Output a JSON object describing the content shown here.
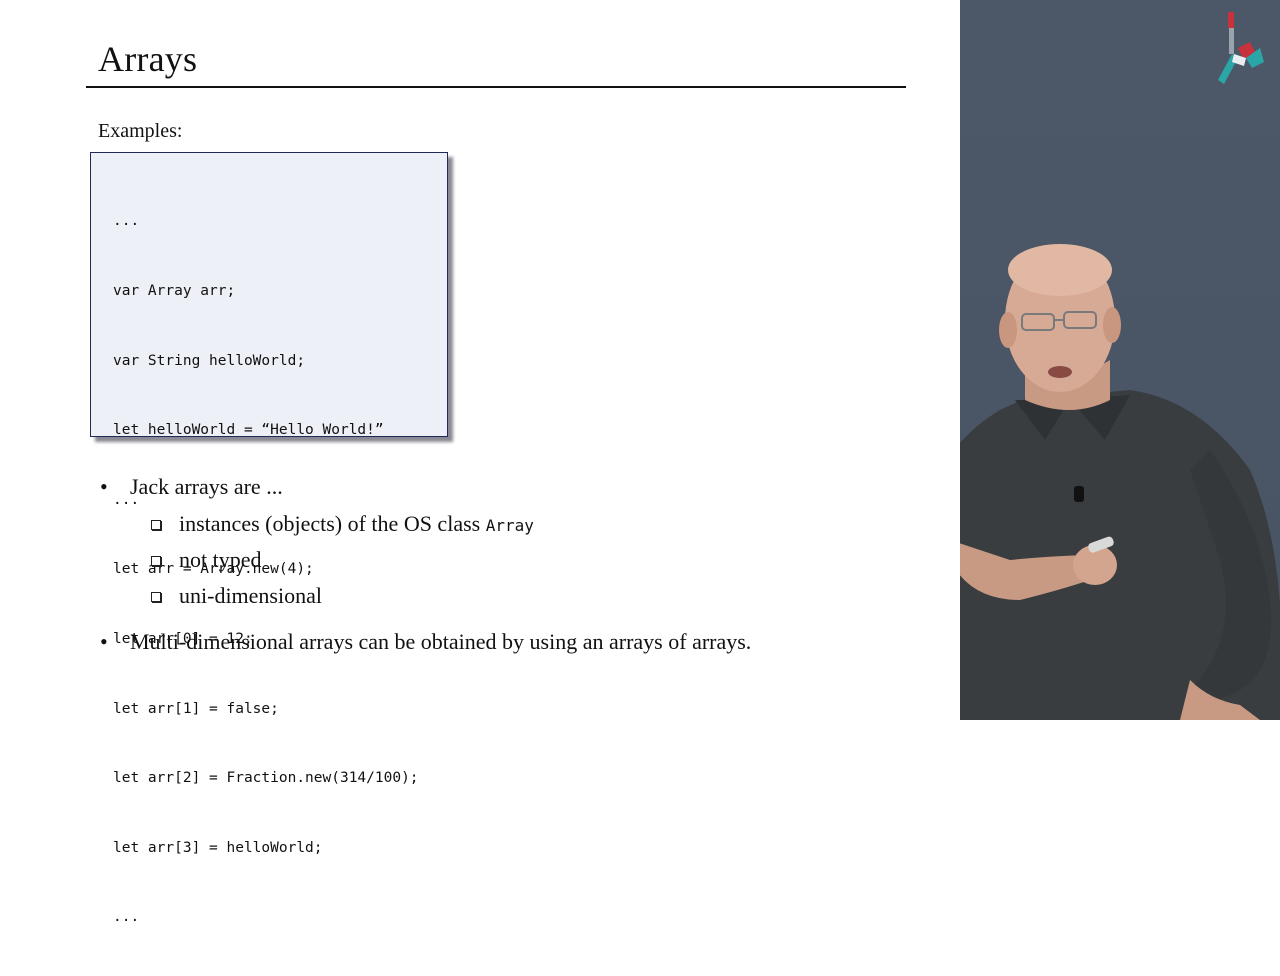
{
  "slide": {
    "title": "Arrays",
    "examples_label": "Examples:",
    "code_lines": [
      "...",
      "var Array arr;",
      "var String helloWorld;",
      "let helloWorld = “Hello World!”",
      "...",
      "let arr = Array.new(4);",
      "let arr[0] = 12;",
      "let arr[1] = false;",
      "let arr[2] = Fraction.new(314/100);",
      "let arr[3] = helloWorld;",
      "..."
    ],
    "bullets": [
      {
        "text": "Jack arrays are ...",
        "sub": [
          {
            "text": "instances (objects) of the OS class ",
            "code": "Array"
          },
          {
            "text": "not typed"
          },
          {
            "text": "uni-dimensional"
          }
        ]
      },
      {
        "text": "Multi-dimensional arrays can be obtained by using an arrays of arrays."
      }
    ]
  },
  "colors": {
    "side_panel": "#4b5767",
    "code_background": "#eef0f8",
    "code_border": "#1f2a55",
    "logo_red": "#c8323c",
    "logo_teal": "#2aa6a6"
  }
}
